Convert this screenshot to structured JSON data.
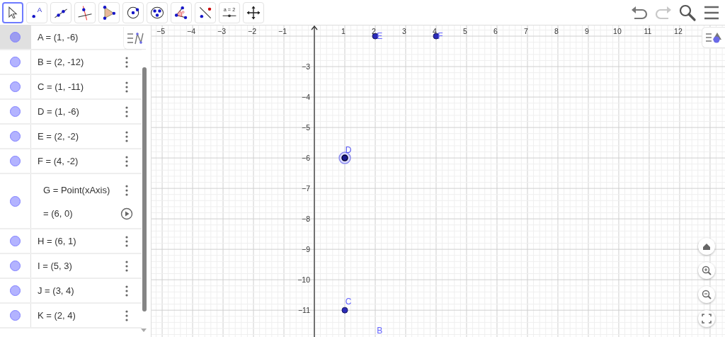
{
  "toolbar": {
    "tools": [
      {
        "kind": "move",
        "selected": true
      },
      {
        "kind": "point",
        "glyph": "A",
        "selected": false
      },
      {
        "kind": "line",
        "selected": false
      },
      {
        "kind": "perpendicular",
        "selected": false
      },
      {
        "kind": "polygon",
        "selected": false
      },
      {
        "kind": "circle",
        "selected": false
      },
      {
        "kind": "circle3",
        "selected": false
      },
      {
        "kind": "angle",
        "selected": false
      },
      {
        "kind": "reflect",
        "selected": false
      },
      {
        "kind": "slider",
        "glyph": "a = 2",
        "selected": false
      },
      {
        "kind": "moveview",
        "selected": false
      }
    ],
    "actions": [
      {
        "kind": "undo",
        "disabled": false
      },
      {
        "kind": "redo",
        "disabled": true
      },
      {
        "kind": "search"
      },
      {
        "kind": "menu"
      }
    ]
  },
  "algebra": {
    "items": [
      {
        "kind": "point",
        "text": "A = (1, -6)",
        "selected": true,
        "menu_button": false
      },
      {
        "kind": "point",
        "text": "B = (2, -12)",
        "selected": false,
        "menu_button": true
      },
      {
        "kind": "point",
        "text": "C = (1, -11)",
        "selected": false,
        "menu_button": true
      },
      {
        "kind": "point",
        "text": "D = (1, -6)",
        "selected": false,
        "menu_button": true
      },
      {
        "kind": "point",
        "text": "E = (2, -2)",
        "selected": false,
        "menu_button": true
      },
      {
        "kind": "point",
        "text": "F = (4, -2)",
        "selected": false,
        "menu_button": true
      },
      {
        "kind": "dependent",
        "text": "G = Point(xAxis)",
        "value": "= (6, 0)",
        "selected": false,
        "menu_button": true
      },
      {
        "kind": "point",
        "text": "H = (6, 1)",
        "selected": false,
        "menu_button": true
      },
      {
        "kind": "point",
        "text": "I = (5, 3)",
        "selected": false,
        "menu_button": true
      },
      {
        "kind": "point",
        "text": "J = (3, 4)",
        "selected": false,
        "menu_button": true
      },
      {
        "kind": "point",
        "text": "K = (2, 4)",
        "selected": false,
        "menu_button": true
      }
    ]
  },
  "graphics": {
    "x_tick_labels": [
      "−5",
      "−4",
      "−3",
      "−2",
      "−1",
      "1",
      "2",
      "3",
      "4",
      "5",
      "6",
      "7",
      "8",
      "9",
      "10",
      "11",
      "12"
    ],
    "y_tick_labels": [
      "−3",
      "−4",
      "−5",
      "−6",
      "−7",
      "−8",
      "−9",
      "−10",
      "−11"
    ],
    "points": [
      {
        "label": "E",
        "selected": false
      },
      {
        "label": "F",
        "selected": false
      },
      {
        "label": "D",
        "selected": true
      },
      {
        "label": "C",
        "selected": false
      },
      {
        "label": "B",
        "selected": false
      }
    ],
    "controls": [
      {
        "kind": "home"
      },
      {
        "kind": "zoomin"
      },
      {
        "kind": "zoomout"
      },
      {
        "kind": "fullscreen"
      }
    ]
  }
}
